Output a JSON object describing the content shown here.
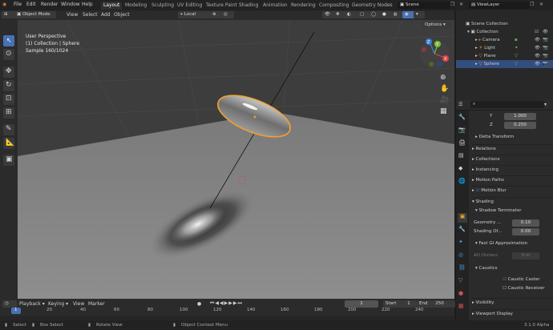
{
  "menubar": {
    "menus": [
      "File",
      "Edit",
      "Render",
      "Window",
      "Help"
    ],
    "workspaces": [
      "Layout",
      "Modeling",
      "Sculpting",
      "UV Editing",
      "Texture Paint",
      "Shading",
      "Animation",
      "Rendering",
      "Compositing",
      "Geometry Nodes"
    ],
    "active_workspace": "Layout",
    "scene": "Scene",
    "view_layer": "ViewLayer"
  },
  "viewport_header": {
    "mode": "Object Mode",
    "menus": [
      "View",
      "Select",
      "Add",
      "Object"
    ],
    "pivot": "Local",
    "options": "Options"
  },
  "overlay": {
    "line1": "User Perspective",
    "line2": "(1) Collection | Sphere",
    "line3": "Sample 160/1024"
  },
  "gizmo": {
    "x": "X",
    "y": "Y",
    "z": "Z"
  },
  "outliner": {
    "root": "Scene Collection",
    "collection": "Collection",
    "items": [
      "Camera",
      "Light",
      "Plane",
      "Sphere"
    ],
    "selected": "Sphere"
  },
  "properties": {
    "y_label": "Y",
    "y_value": "1.000",
    "z_label": "Z",
    "z_value": "0.250",
    "sections": [
      "Delta Transform",
      "Relations",
      "Collections",
      "Instancing",
      "Motion Paths",
      "Motion Blur",
      "Shading"
    ],
    "shadow_terminator": "Shadow Terminator",
    "geometry_label": "Geometry ...",
    "geometry_value": "0.10",
    "shading_label": "Shading Of...",
    "shading_value": "0.00",
    "fast_gi": "Fast GI Approximation",
    "ao_label": "AO Distanc",
    "ao_value": "0 m",
    "caustics": "Caustics",
    "caustic_caster": "Caustic Caster",
    "caustic_receiver": "Caustic Receiver",
    "visibility": "Visibility",
    "viewport_display": "Viewport Display"
  },
  "timeline": {
    "menus": [
      "Playback",
      "Keying",
      "View",
      "Marker"
    ],
    "current": "1",
    "start_label": "Start",
    "start": "1",
    "end_label": "End",
    "end": "250",
    "ticks": [
      "1",
      "20",
      "40",
      "60",
      "80",
      "100",
      "120",
      "140",
      "160",
      "180",
      "200",
      "220",
      "240"
    ]
  },
  "statusbar": {
    "select": "Select",
    "box_select": "Box Select",
    "rotate_view": "Rotate View",
    "context_menu": "Object Context Menu",
    "version": "3.1.0 Alpha"
  },
  "colors": {
    "accent": "#4772b3",
    "selection_orange": "#f0a030",
    "active_tab": "#303030"
  }
}
